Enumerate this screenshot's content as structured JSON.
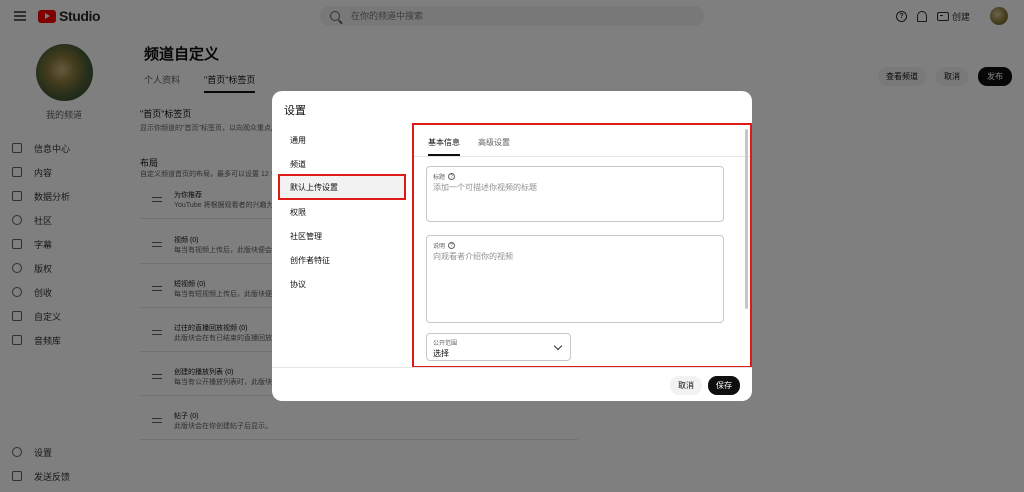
{
  "topbar": {
    "logo_text": "Studio",
    "search_placeholder": "在你的频道中搜索",
    "create_label": "创建"
  },
  "sidebar": {
    "channel_label": "我的频道",
    "items": [
      {
        "label": "信息中心",
        "icon": "dashboard-icon"
      },
      {
        "label": "内容",
        "icon": "content-icon"
      },
      {
        "label": "数据分析",
        "icon": "analytics-icon"
      },
      {
        "label": "社区",
        "icon": "community-icon"
      },
      {
        "label": "字幕",
        "icon": "subtitles-icon"
      },
      {
        "label": "版权",
        "icon": "copyright-icon"
      },
      {
        "label": "创收",
        "icon": "monetization-icon"
      },
      {
        "label": "自定义",
        "icon": "customization-icon"
      },
      {
        "label": "音频库",
        "icon": "audio-library-icon"
      }
    ],
    "bottom_items": [
      {
        "label": "设置",
        "icon": "settings-icon"
      },
      {
        "label": "发送反馈",
        "icon": "feedback-icon"
      }
    ]
  },
  "main": {
    "title": "频道自定义",
    "tabs": [
      "个人资料",
      "\"首页\"标签页"
    ],
    "view_channel": "查看频道",
    "cancel": "取消",
    "publish": "发布",
    "home_section_title": "\"首页\"标签页",
    "home_section_desc": "显示你频道的\"首页\"标签页，以向观众重点展示",
    "layout_title": "布局",
    "layout_desc": "自定义频道首页的布局，最多可以设置 12 个版块",
    "rows": [
      {
        "title": "为你推荐",
        "desc": "YouTube 将根据观看者的兴趣为其推荐内容"
      },
      {
        "title": "视频 (0)",
        "desc": "每当有视频上传后，此版块便会显示"
      },
      {
        "title": "短视频 (0)",
        "desc": "每当有短视频上传后，此版块便会显示"
      },
      {
        "title": "过往的直播回放视频 (0)",
        "desc": "此版块会在有已结束的直播回放时"
      },
      {
        "title": "创建的播放列表 (0)",
        "desc": "每当有公开播放列表时，此版块便会显示"
      },
      {
        "title": "帖子 (0)",
        "desc": "此版块会在你创建帖子后显示。"
      }
    ]
  },
  "modal": {
    "title": "设置",
    "nav": [
      "通用",
      "频道",
      "默认上传设置",
      "权限",
      "社区管理",
      "创作者特征",
      "协议"
    ],
    "active_nav_index": 2,
    "tabs": [
      "基本信息",
      "高级设置"
    ],
    "title_field": {
      "label": "标题",
      "placeholder": "添加一个可描述你视频的标题"
    },
    "desc_field": {
      "label": "说明",
      "placeholder": "向观看者介绍你的视频"
    },
    "visibility": {
      "label": "公开范围",
      "value": "选择"
    },
    "cancel": "取消",
    "save": "保存"
  }
}
